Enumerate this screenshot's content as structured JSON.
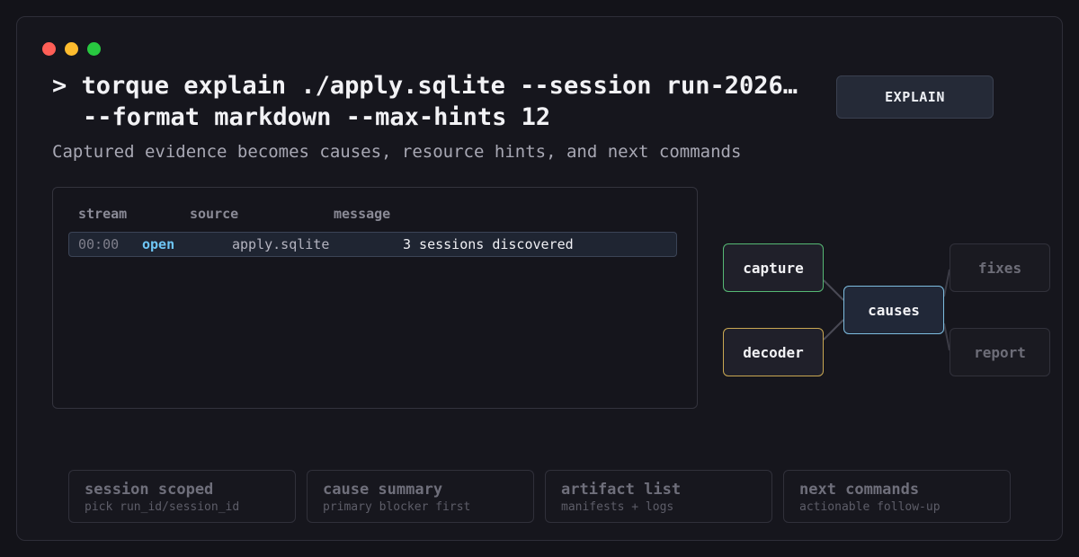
{
  "window": {
    "controls": [
      {
        "name": "close",
        "color": "#ff5f57"
      },
      {
        "name": "minimize",
        "color": "#febc2e"
      },
      {
        "name": "zoom",
        "color": "#28c840"
      }
    ]
  },
  "command": {
    "line1": "> torque explain ./apply.sqlite --session run-2026…",
    "line2": "--format markdown --max-hints 12"
  },
  "explain_button": "EXPLAIN",
  "subtitle": "Captured evidence becomes causes, resource hints, and next commands",
  "stream": {
    "headers": [
      "stream",
      "source",
      "message"
    ],
    "rows": [
      {
        "time": "00:00",
        "kind": "open",
        "source": "apply.sqlite",
        "message": "3 sessions discovered"
      }
    ]
  },
  "flow": {
    "capture": "capture",
    "decoder": "decoder",
    "causes": "causes",
    "fixes": "fixes",
    "report": "report",
    "colors": {
      "capture": "#56b874",
      "decoder": "#c9a752",
      "causes": "#7dbde0"
    }
  },
  "cards": [
    {
      "title": "session scoped",
      "sub": "pick run_id/session_id"
    },
    {
      "title": "cause summary",
      "sub": "primary blocker first"
    },
    {
      "title": "artifact list",
      "sub": "manifests + logs"
    },
    {
      "title": "next commands",
      "sub": "actionable follow-up"
    }
  ]
}
